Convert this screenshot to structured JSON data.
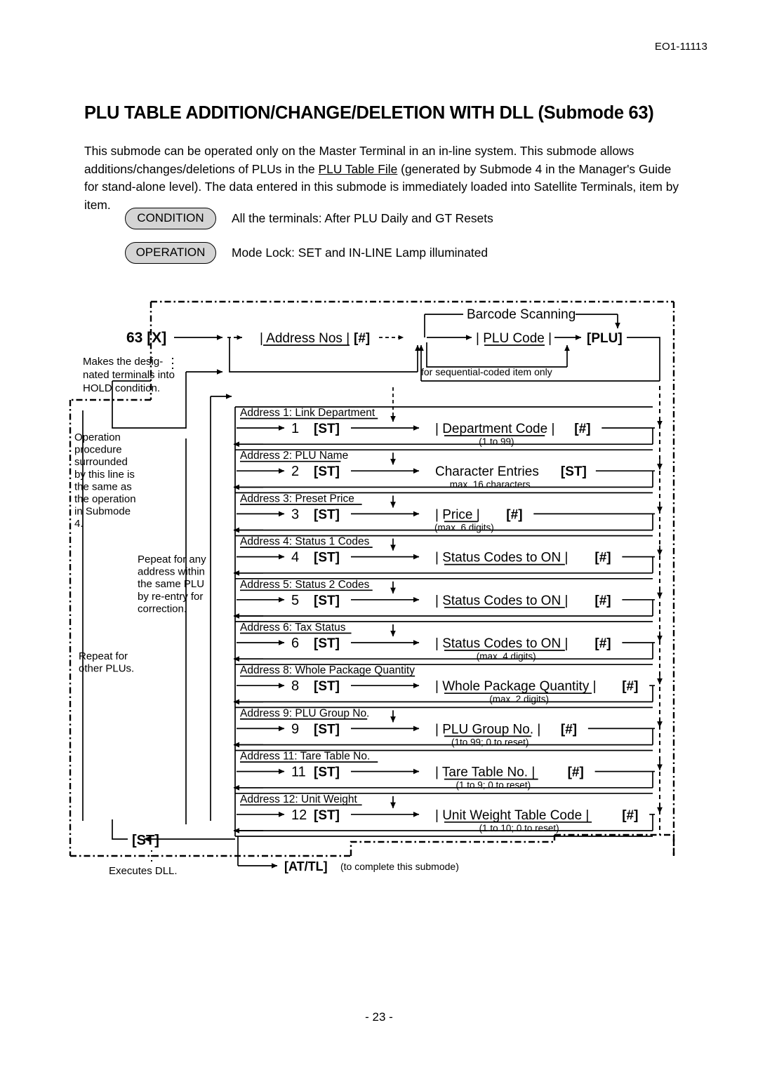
{
  "header": {
    "doc_code": "EO1-11113"
  },
  "title": "PLU TABLE ADDITION/CHANGE/DELETION WITH DLL (Submode 63)",
  "intro": {
    "p1": "This submode can be operated only on the Master Terminal in an in-line system.  This submode allows additions/changes/deletions of PLUs in the ",
    "underlined": "PLU Table File",
    "p2": " (generated by Submode 4 in the Manager's Guide for stand-alone level).  The data entered in this submode is immediately loaded into Satellite Terminals, item by item."
  },
  "condition": {
    "label": "CONDITION",
    "text": "All the terminals: After PLU Daily and GT Resets"
  },
  "operation": {
    "label": "OPERATION",
    "text": "Mode Lock: SET and IN-LINE Lamp illuminated"
  },
  "diagram": {
    "start_key": "63 [X]",
    "start_note_l1": "Makes the desig-",
    "start_note_l2": "nated terminals into",
    "start_note_l3": "HOLD condition.",
    "address_nos": "| Address Nos |",
    "address_nos_key": "[#]",
    "barcode_scanning": "Barcode Scanning",
    "plu_code": "| PLU Code |",
    "plu_key": "[PLU]",
    "sequential_note": "for sequential-coded item only",
    "submode_note_lines": [
      "Operation",
      "procedure",
      "surrounded",
      "by this line is",
      "the same as",
      "the operation",
      "in Submode",
      "4."
    ],
    "repeat_address_lines": [
      "Pepeat for any",
      "address within",
      "the same PLU",
      "by re-entry for",
      "correction."
    ],
    "repeat_plu_lines": [
      "Repeat for",
      "other PLUs."
    ],
    "rows": [
      {
        "caption": "Address 1: Link Department",
        "num": "1",
        "key": "[ST]",
        "entry": "| Department Code |",
        "entry_key": "[#]",
        "note": "(1 to 99)"
      },
      {
        "caption": "Address 2: PLU Name",
        "num": "2",
        "key": "[ST]",
        "entry": "Character Entries",
        "entry_key": "[ST]",
        "note": "max. 16 characters"
      },
      {
        "caption": "Address 3: Preset Price",
        "num": "3",
        "key": "[ST]",
        "entry": "| Price |",
        "entry_key": "[#]",
        "note": "(max. 6 digits)"
      },
      {
        "caption": "Address 4: Status 1 Codes",
        "num": "4",
        "key": "[ST]",
        "entry": "| Status Codes to ON |",
        "entry_key": "[#]",
        "note": ""
      },
      {
        "caption": "Address 5: Status 2 Codes",
        "num": "5",
        "key": "[ST]",
        "entry": "| Status Codes to ON |",
        "entry_key": "[#]",
        "note": ""
      },
      {
        "caption": "Address 6: Tax Status",
        "num": "6",
        "key": "[ST]",
        "entry": "| Status Codes to ON |",
        "entry_key": "[#]",
        "note": "(max. 4 digits)"
      },
      {
        "caption": "Address 8: Whole Package Quantity",
        "num": "8",
        "key": "[ST]",
        "entry": "| Whole Package Quantity |",
        "entry_key": "[#]",
        "note": "(max. 2 digits)"
      },
      {
        "caption": "Address 9: PLU Group No.",
        "num": "9",
        "key": "[ST]",
        "entry": "| PLU Group No. |",
        "entry_key": "[#]",
        "note": "(1to 99; 0 to reset)"
      },
      {
        "caption": "Address 11: Tare Table No.",
        "num": "11",
        "key": "[ST]",
        "entry": "| Tare Table No. |",
        "entry_key": "[#]",
        "note": "(1 to 9; 0 to reset)"
      },
      {
        "caption": "Address 12: Unit Weight",
        "num": "12",
        "key": "[ST]",
        "entry": "| Unit Weight Table Code |",
        "entry_key": "[#]",
        "note": "(1 to 10; 0 to reset)"
      }
    ],
    "finish_key": "[ST]",
    "finish_note": "Executes DLL.",
    "attl_key": "[AT/TL]",
    "attl_note": "(to complete this submode)"
  },
  "footer": {
    "page_number": "- 23 -"
  }
}
